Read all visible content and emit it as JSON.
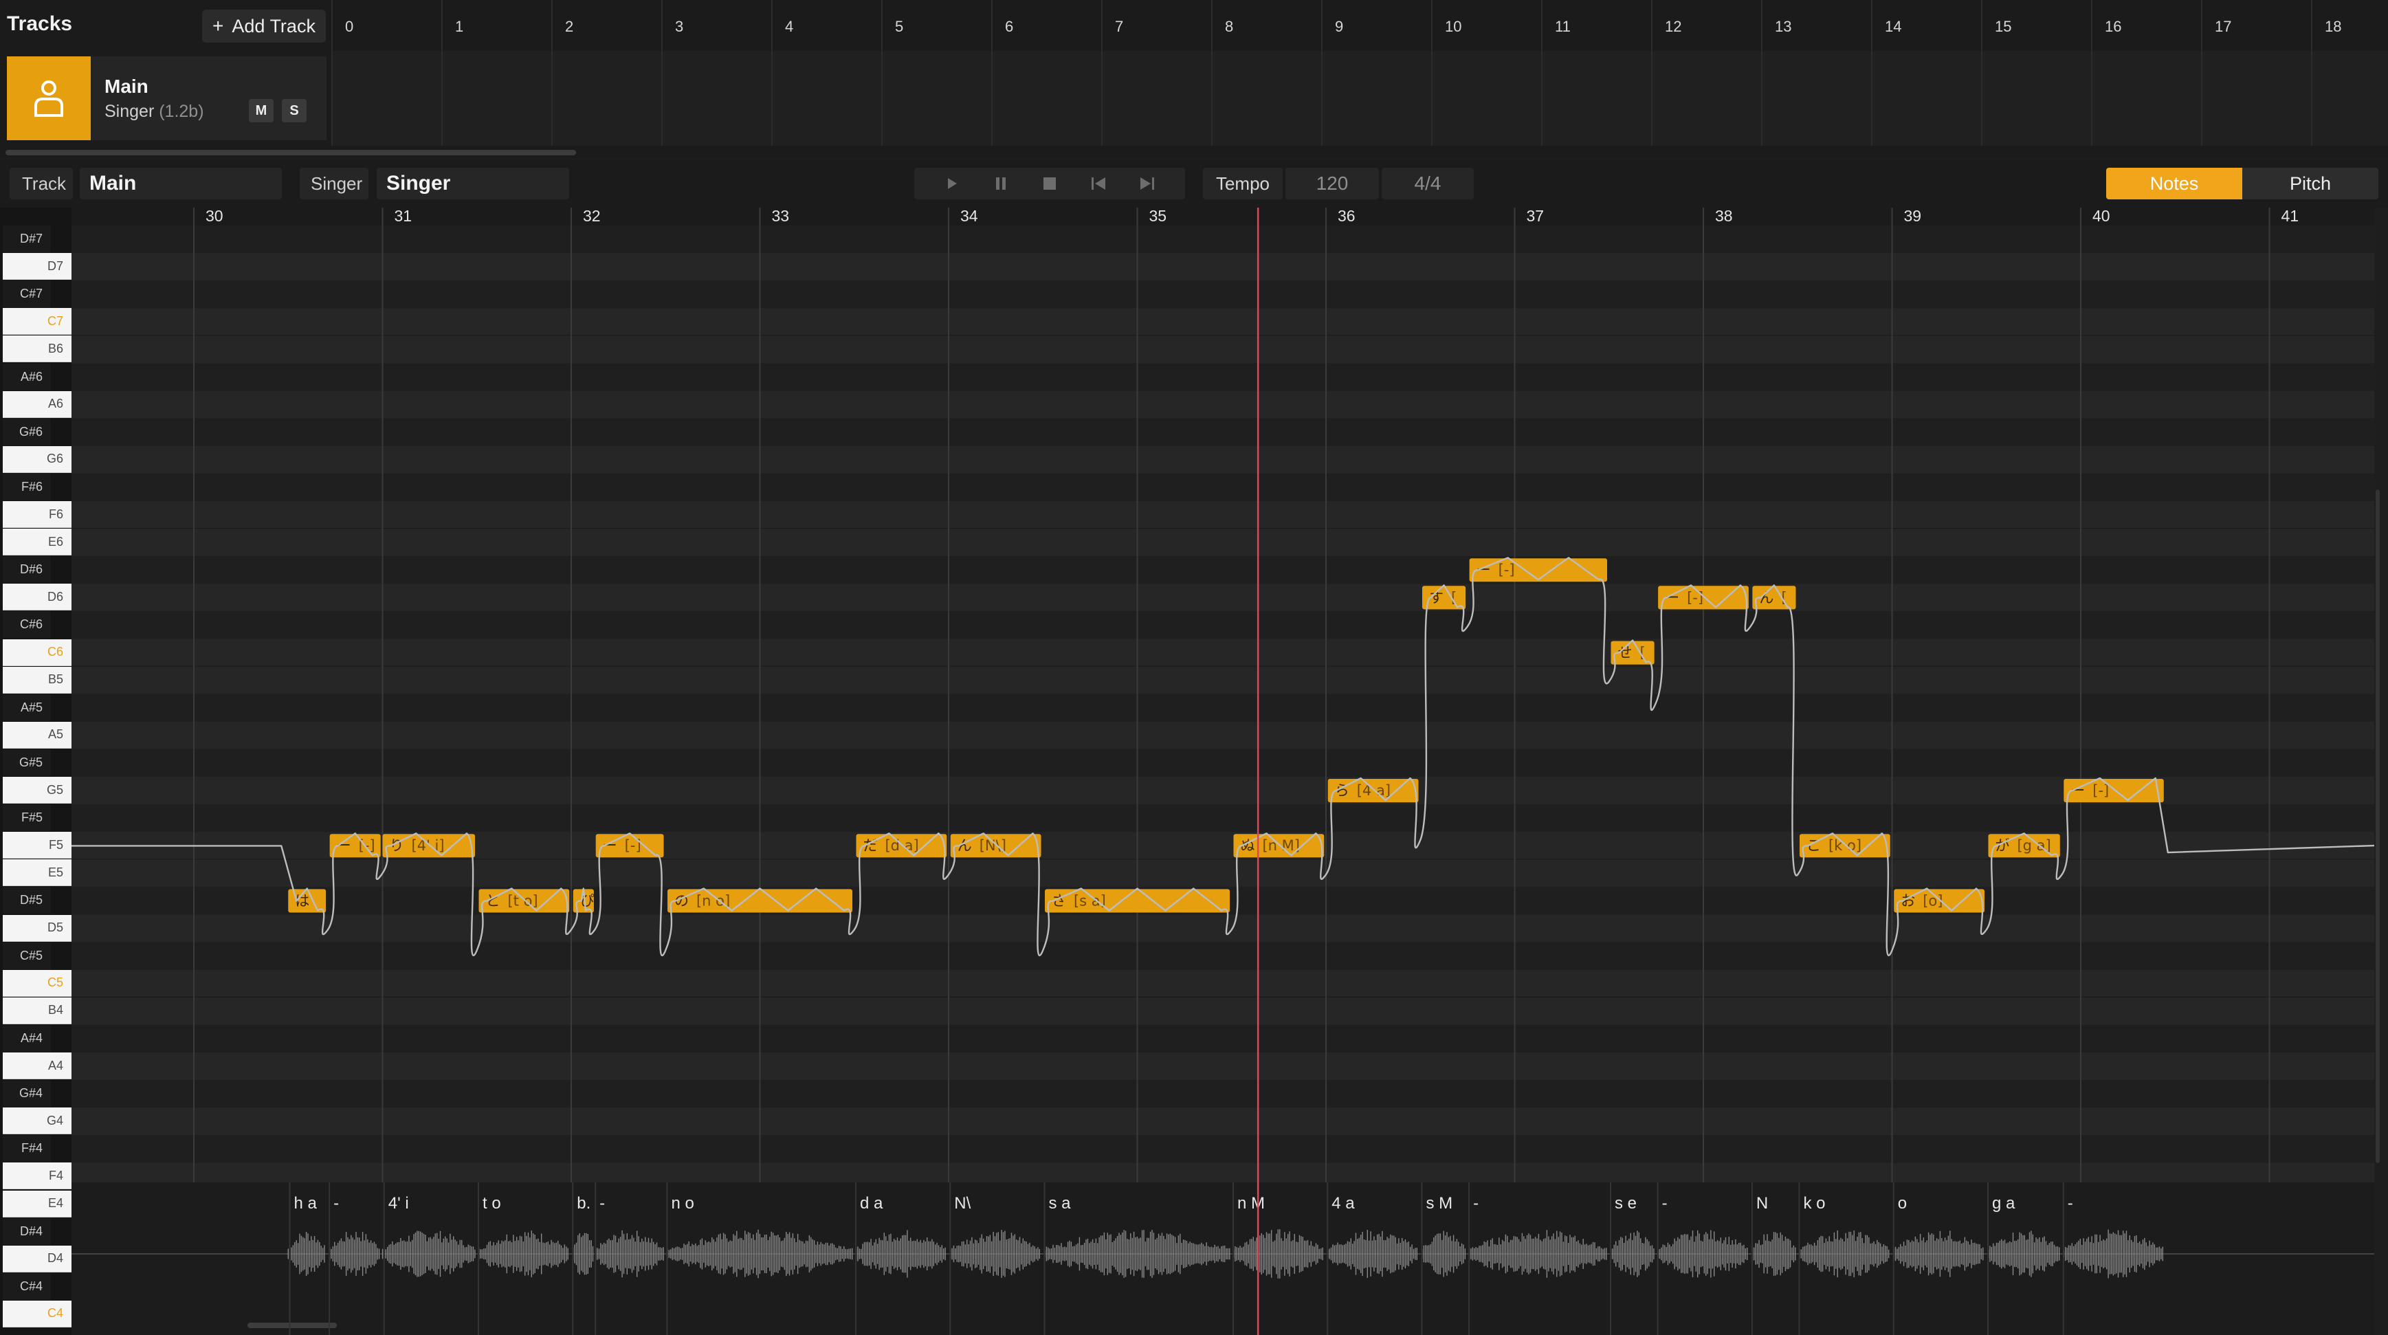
{
  "tracks": {
    "title": "Tracks",
    "add_track_label": "Add Track",
    "ruler": [
      "0",
      "1",
      "2",
      "3",
      "4",
      "5",
      "6",
      "7",
      "8",
      "9",
      "10",
      "11",
      "12",
      "13",
      "14",
      "15",
      "16",
      "17",
      "18"
    ],
    "track": {
      "name": "Main",
      "singer": "Singer",
      "version": "(1.2b)",
      "mute_label": "M",
      "solo_label": "S"
    }
  },
  "toolbar": {
    "track_label": "Track",
    "track_value": "Main",
    "singer_label": "Singer",
    "singer_value": "Singer",
    "transport_icons": [
      "play-icon",
      "pause-icon",
      "stop-icon",
      "skip-start-icon",
      "skip-end-icon"
    ],
    "tempo_label": "Tempo",
    "tempo_value": "120",
    "time_signature": "4/4",
    "mode_notes": "Notes",
    "mode_pitch": "Pitch",
    "active_mode": "Notes"
  },
  "piano_roll": {
    "measures": [
      "30",
      "31",
      "32",
      "33",
      "34",
      "35",
      "36",
      "37",
      "38",
      "39",
      "40",
      "41"
    ],
    "playhead_measure": 35.64,
    "keys": [
      "D#7",
      "D7",
      "C#7",
      "C7",
      "B6",
      "A#6",
      "A6",
      "G#6",
      "G6",
      "F#6",
      "F6",
      "E6",
      "D#6",
      "D6",
      "C#6",
      "C6",
      "B5",
      "A#5",
      "A5",
      "G#5",
      "G5",
      "F#5",
      "F5",
      "E5",
      "D#5",
      "D5",
      "C#5",
      "C5",
      "B4",
      "A#4",
      "A4",
      "G#4",
      "G4",
      "F#4",
      "F4",
      "E4",
      "D#4",
      "D4",
      "C#4",
      "C4"
    ],
    "notes": [
      {
        "lyric": "は",
        "phoneme": "",
        "pitch": "D#5",
        "start": 30.5,
        "end": 30.7
      },
      {
        "lyric": "ー",
        "phoneme": "[-]",
        "pitch": "F5",
        "start": 30.72,
        "end": 30.99
      },
      {
        "lyric": "り",
        "phoneme": "[4' i]",
        "pitch": "F5",
        "start": 31.0,
        "end": 31.49
      },
      {
        "lyric": "と",
        "phoneme": "[t o]",
        "pitch": "D#5",
        "start": 31.51,
        "end": 31.99
      },
      {
        "lyric": "ぴ",
        "phoneme": "",
        "pitch": "D#5",
        "start": 32.01,
        "end": 32.12
      },
      {
        "lyric": "ー",
        "phoneme": "[-]",
        "pitch": "F5",
        "start": 32.13,
        "end": 32.49
      },
      {
        "lyric": "の",
        "phoneme": "[n o]",
        "pitch": "D#5",
        "start": 32.51,
        "end": 33.49
      },
      {
        "lyric": "だ",
        "phoneme": "[d a]",
        "pitch": "F5",
        "start": 33.51,
        "end": 33.99
      },
      {
        "lyric": "ん",
        "phoneme": "[N\\]",
        "pitch": "F5",
        "start": 34.01,
        "end": 34.49
      },
      {
        "lyric": "さ",
        "phoneme": "[s a]",
        "pitch": "D#5",
        "start": 34.51,
        "end": 35.49
      },
      {
        "lyric": "ぬ",
        "phoneme": "[n M]",
        "pitch": "F5",
        "start": 35.51,
        "end": 35.99
      },
      {
        "lyric": "ら",
        "phoneme": "[4 a]",
        "pitch": "G5",
        "start": 36.01,
        "end": 36.49
      },
      {
        "lyric": "す",
        "phoneme": "[",
        "pitch": "D6",
        "start": 36.51,
        "end": 36.74
      },
      {
        "lyric": "ー",
        "phoneme": "[-]",
        "pitch": "D#6",
        "start": 36.76,
        "end": 37.49
      },
      {
        "lyric": "せ",
        "phoneme": "[",
        "pitch": "C6",
        "start": 37.51,
        "end": 37.74
      },
      {
        "lyric": "ー",
        "phoneme": "[-]",
        "pitch": "D6",
        "start": 37.76,
        "end": 38.24
      },
      {
        "lyric": "ん",
        "phoneme": "[",
        "pitch": "D6",
        "start": 38.26,
        "end": 38.49
      },
      {
        "lyric": "こ",
        "phoneme": "[k o]",
        "pitch": "F5",
        "start": 38.51,
        "end": 38.99
      },
      {
        "lyric": "お",
        "phoneme": "[o]",
        "pitch": "D#5",
        "start": 39.01,
        "end": 39.49
      },
      {
        "lyric": "が",
        "phoneme": "[g a]",
        "pitch": "F5",
        "start": 39.51,
        "end": 39.89
      },
      {
        "lyric": "ー",
        "phoneme": "[-]",
        "pitch": "G5",
        "start": 39.91,
        "end": 40.44
      }
    ],
    "phonemes": [
      {
        "text": "h a",
        "pos": 30.53
      },
      {
        "text": "-",
        "pos": 30.74
      },
      {
        "text": "4' i",
        "pos": 31.03
      },
      {
        "text": "t o",
        "pos": 31.53
      },
      {
        "text": "b.",
        "pos": 32.03
      },
      {
        "text": "-",
        "pos": 32.15
      },
      {
        "text": "n o",
        "pos": 32.53
      },
      {
        "text": "d a",
        "pos": 33.53
      },
      {
        "text": "N\\",
        "pos": 34.03
      },
      {
        "text": "s a",
        "pos": 34.53
      },
      {
        "text": "n M",
        "pos": 35.53
      },
      {
        "text": "4 a",
        "pos": 36.03
      },
      {
        "text": "s M",
        "pos": 36.53
      },
      {
        "text": "-",
        "pos": 36.78
      },
      {
        "text": "s e",
        "pos": 37.53
      },
      {
        "text": "-",
        "pos": 37.78
      },
      {
        "text": "N",
        "pos": 38.28
      },
      {
        "text": "k o",
        "pos": 38.53
      },
      {
        "text": "o",
        "pos": 39.03
      },
      {
        "text": "g a",
        "pos": 39.53
      },
      {
        "text": "-",
        "pos": 39.93
      }
    ],
    "colors": {
      "note": "#e69f0e",
      "note_text": "#6e4800",
      "playhead": "#e0435a",
      "pitch_curve": "#bdbdbd",
      "c_key_label": "#e8a01b"
    }
  }
}
